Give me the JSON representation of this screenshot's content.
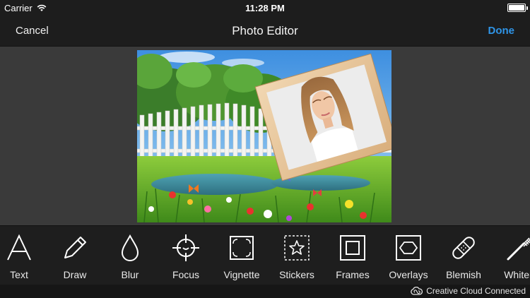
{
  "status_bar": {
    "carrier": "Carrier",
    "wifi_icon": "wifi-icon",
    "time": "11:28 PM",
    "battery_level": 1.0
  },
  "nav": {
    "cancel_label": "Cancel",
    "title": "Photo Editor",
    "done_label": "Done",
    "done_color": "#2f95e8"
  },
  "tools": [
    {
      "label": "Text",
      "icon": "text-icon"
    },
    {
      "label": "Draw",
      "icon": "pencil-icon"
    },
    {
      "label": "Blur",
      "icon": "droplet-icon"
    },
    {
      "label": "Focus",
      "icon": "crosshair-icon"
    },
    {
      "label": "Vignette",
      "icon": "vignette-icon"
    },
    {
      "label": "Stickers",
      "icon": "star-sticker-icon"
    },
    {
      "label": "Frames",
      "icon": "frame-icon"
    },
    {
      "label": "Overlays",
      "icon": "hexagon-icon"
    },
    {
      "label": "Blemish",
      "icon": "bandage-icon"
    },
    {
      "label": "Whiten",
      "icon": "toothbrush-icon"
    }
  ],
  "footer": {
    "cc_icon": "creative-cloud-icon",
    "cc_label": "Creative Cloud Connected"
  }
}
